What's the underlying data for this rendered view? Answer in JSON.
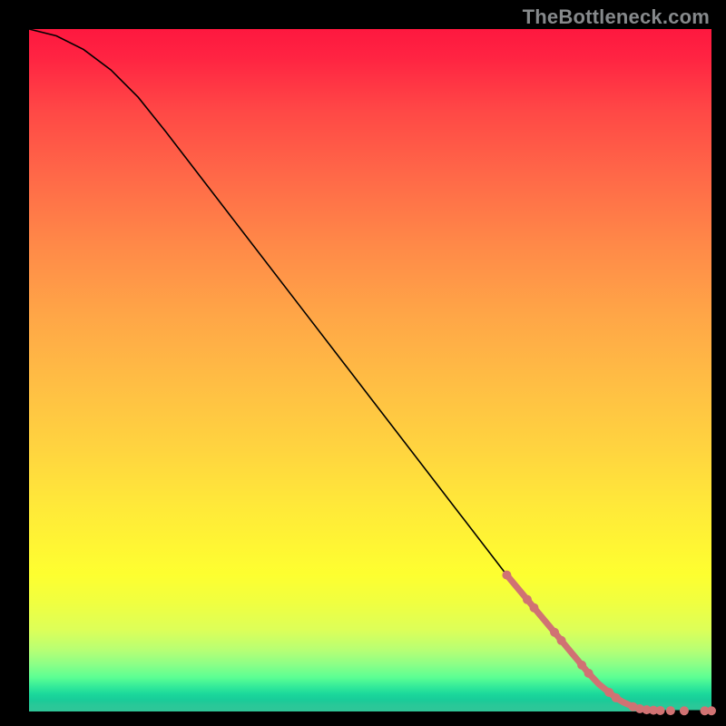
{
  "watermark": "TheBottleneck.com",
  "chart_data": {
    "type": "line",
    "title": "",
    "xlabel": "",
    "ylabel": "",
    "xlim": [
      0,
      100
    ],
    "ylim": [
      0,
      100
    ],
    "series": [
      {
        "name": "curve",
        "x": [
          0,
          4,
          8,
          12,
          16,
          20,
          30,
          40,
          50,
          60,
          70,
          80,
          85,
          88,
          90,
          92,
          95,
          100
        ],
        "y": [
          100,
          99,
          97,
          94,
          90,
          85,
          72,
          59,
          46,
          33,
          20,
          7.5,
          3,
          1,
          0.3,
          0.1,
          0.1,
          0.1
        ]
      }
    ],
    "highlight_points": {
      "name": "highlighted-range",
      "x": [
        70,
        71.5,
        73,
        74,
        75.5,
        77,
        78,
        79.5,
        81,
        82,
        83.5,
        85,
        86,
        87,
        88.5,
        89.5,
        90.5,
        91.5,
        92.5,
        94,
        96,
        99,
        100
      ],
      "y": [
        20,
        18.2,
        16.4,
        15.2,
        13.4,
        11.6,
        10.4,
        8.6,
        6.8,
        5.6,
        4.0,
        2.8,
        2.0,
        1.4,
        0.7,
        0.4,
        0.25,
        0.18,
        0.14,
        0.12,
        0.1,
        0.1,
        0.1
      ]
    }
  }
}
